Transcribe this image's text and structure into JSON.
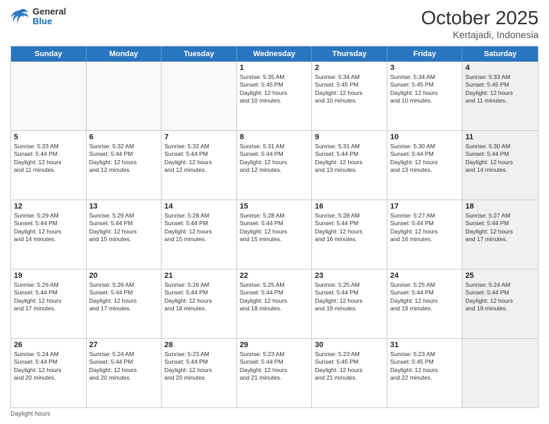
{
  "header": {
    "logo_general": "General",
    "logo_blue": "Blue",
    "title": "October 2025",
    "subtitle": "Kertajadi, Indonesia"
  },
  "days_of_week": [
    "Sunday",
    "Monday",
    "Tuesday",
    "Wednesday",
    "Thursday",
    "Friday",
    "Saturday"
  ],
  "weeks": [
    [
      {
        "day": "",
        "text": "",
        "empty": true
      },
      {
        "day": "",
        "text": "",
        "empty": true
      },
      {
        "day": "",
        "text": "",
        "empty": true
      },
      {
        "day": "1",
        "text": "Sunrise: 5:35 AM\nSunset: 5:45 PM\nDaylight: 12 hours\nand 10 minutes."
      },
      {
        "day": "2",
        "text": "Sunrise: 5:34 AM\nSunset: 5:45 PM\nDaylight: 12 hours\nand 10 minutes."
      },
      {
        "day": "3",
        "text": "Sunrise: 5:34 AM\nSunset: 5:45 PM\nDaylight: 12 hours\nand 10 minutes."
      },
      {
        "day": "4",
        "text": "Sunrise: 5:33 AM\nSunset: 5:45 PM\nDaylight: 12 hours\nand 11 minutes.",
        "shaded": true
      }
    ],
    [
      {
        "day": "5",
        "text": "Sunrise: 5:33 AM\nSunset: 5:44 PM\nDaylight: 12 hours\nand 11 minutes."
      },
      {
        "day": "6",
        "text": "Sunrise: 5:32 AM\nSunset: 5:44 PM\nDaylight: 12 hours\nand 12 minutes."
      },
      {
        "day": "7",
        "text": "Sunrise: 5:32 AM\nSunset: 5:44 PM\nDaylight: 12 hours\nand 12 minutes."
      },
      {
        "day": "8",
        "text": "Sunrise: 5:31 AM\nSunset: 5:44 PM\nDaylight: 12 hours\nand 12 minutes."
      },
      {
        "day": "9",
        "text": "Sunrise: 5:31 AM\nSunset: 5:44 PM\nDaylight: 12 hours\nand 13 minutes."
      },
      {
        "day": "10",
        "text": "Sunrise: 5:30 AM\nSunset: 5:44 PM\nDaylight: 12 hours\nand 13 minutes."
      },
      {
        "day": "11",
        "text": "Sunrise: 5:30 AM\nSunset: 5:44 PM\nDaylight: 12 hours\nand 14 minutes.",
        "shaded": true
      }
    ],
    [
      {
        "day": "12",
        "text": "Sunrise: 5:29 AM\nSunset: 5:44 PM\nDaylight: 12 hours\nand 14 minutes."
      },
      {
        "day": "13",
        "text": "Sunrise: 5:29 AM\nSunset: 5:44 PM\nDaylight: 12 hours\nand 15 minutes."
      },
      {
        "day": "14",
        "text": "Sunrise: 5:28 AM\nSunset: 5:44 PM\nDaylight: 12 hours\nand 15 minutes."
      },
      {
        "day": "15",
        "text": "Sunrise: 5:28 AM\nSunset: 5:44 PM\nDaylight: 12 hours\nand 15 minutes."
      },
      {
        "day": "16",
        "text": "Sunrise: 5:28 AM\nSunset: 5:44 PM\nDaylight: 12 hours\nand 16 minutes."
      },
      {
        "day": "17",
        "text": "Sunrise: 5:27 AM\nSunset: 5:44 PM\nDaylight: 12 hours\nand 16 minutes."
      },
      {
        "day": "18",
        "text": "Sunrise: 5:27 AM\nSunset: 5:44 PM\nDaylight: 12 hours\nand 17 minutes.",
        "shaded": true
      }
    ],
    [
      {
        "day": "19",
        "text": "Sunrise: 5:26 AM\nSunset: 5:44 PM\nDaylight: 12 hours\nand 17 minutes."
      },
      {
        "day": "20",
        "text": "Sunrise: 5:26 AM\nSunset: 5:44 PM\nDaylight: 12 hours\nand 17 minutes."
      },
      {
        "day": "21",
        "text": "Sunrise: 5:26 AM\nSunset: 5:44 PM\nDaylight: 12 hours\nand 18 minutes."
      },
      {
        "day": "22",
        "text": "Sunrise: 5:25 AM\nSunset: 5:44 PM\nDaylight: 12 hours\nand 18 minutes."
      },
      {
        "day": "23",
        "text": "Sunrise: 5:25 AM\nSunset: 5:44 PM\nDaylight: 12 hours\nand 19 minutes."
      },
      {
        "day": "24",
        "text": "Sunrise: 5:25 AM\nSunset: 5:44 PM\nDaylight: 12 hours\nand 19 minutes."
      },
      {
        "day": "25",
        "text": "Sunrise: 5:24 AM\nSunset: 5:44 PM\nDaylight: 12 hours\nand 19 minutes.",
        "shaded": true
      }
    ],
    [
      {
        "day": "26",
        "text": "Sunrise: 5:24 AM\nSunset: 5:44 PM\nDaylight: 12 hours\nand 20 minutes."
      },
      {
        "day": "27",
        "text": "Sunrise: 5:24 AM\nSunset: 5:44 PM\nDaylight: 12 hours\nand 20 minutes."
      },
      {
        "day": "28",
        "text": "Sunrise: 5:23 AM\nSunset: 5:44 PM\nDaylight: 12 hours\nand 20 minutes."
      },
      {
        "day": "29",
        "text": "Sunrise: 5:23 AM\nSunset: 5:44 PM\nDaylight: 12 hours\nand 21 minutes."
      },
      {
        "day": "30",
        "text": "Sunrise: 5:23 AM\nSunset: 5:45 PM\nDaylight: 12 hours\nand 21 minutes."
      },
      {
        "day": "31",
        "text": "Sunrise: 5:23 AM\nSunset: 5:45 PM\nDaylight: 12 hours\nand 22 minutes."
      },
      {
        "day": "",
        "text": "",
        "empty": true,
        "shaded": true
      }
    ]
  ],
  "footer": {
    "note": "Daylight hours"
  }
}
